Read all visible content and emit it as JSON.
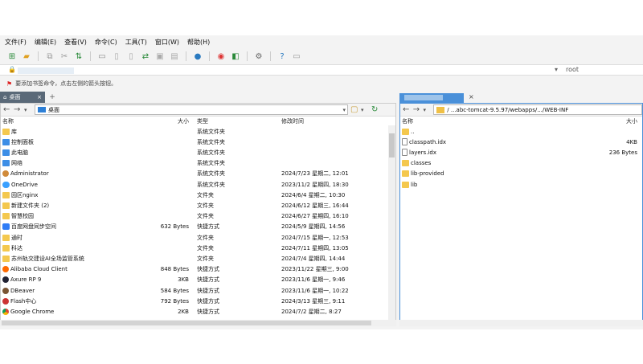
{
  "menu": [
    "文件(F)",
    "编辑(E)",
    "查看(V)",
    "命令(C)",
    "工具(T)",
    "窗口(W)",
    "帮助(H)"
  ],
  "address": {
    "user": "root"
  },
  "notice": "要添加书签命令，点击左侧的箭头按钮。",
  "tab": {
    "label": "桌面",
    "close": "×",
    "add": "+"
  },
  "left": {
    "path": "桌面",
    "columns": {
      "name": "名称",
      "size": "大小",
      "type": "类型",
      "date": "修改时间"
    },
    "rows": [
      {
        "name": "库",
        "size": "",
        "type": "系统文件夹",
        "date": "",
        "icon": "fld"
      },
      {
        "name": "控制面板",
        "size": "",
        "type": "系统文件夹",
        "date": "",
        "icon": "sys"
      },
      {
        "name": "此电脑",
        "size": "",
        "type": "系统文件夹",
        "date": "",
        "icon": "sys"
      },
      {
        "name": "网络",
        "size": "",
        "type": "系统文件夹",
        "date": "",
        "icon": "sys"
      },
      {
        "name": "Administrator",
        "size": "",
        "type": "系统文件夹",
        "date": "2024/7/23 星期二, 12:01",
        "icon": "user"
      },
      {
        "name": "OneDrive",
        "size": "",
        "type": "系统文件夹",
        "date": "2023/11/2 星期四, 18:30",
        "icon": "cloud"
      },
      {
        "name": "园区nginx",
        "size": "",
        "type": "文件夹",
        "date": "2024/6/4 星期二, 10:30",
        "icon": "fld"
      },
      {
        "name": "新建文件夹 (2)",
        "size": "",
        "type": "文件夹",
        "date": "2024/6/12 星期三, 16:44",
        "icon": "fld"
      },
      {
        "name": "智慧校园",
        "size": "",
        "type": "文件夹",
        "date": "2024/6/27 星期四, 16:10",
        "icon": "fld"
      },
      {
        "name": "百度网盘同步空间",
        "size": "632 Bytes",
        "type": "快捷方式",
        "date": "2024/5/9 星期四, 14:56",
        "icon": "baidu"
      },
      {
        "name": "通时",
        "size": "",
        "type": "文件夹",
        "date": "2024/7/15 星期一, 12:53",
        "icon": "fld"
      },
      {
        "name": "科达",
        "size": "",
        "type": "文件夹",
        "date": "2024/7/11 星期四, 13:05",
        "icon": "fld"
      },
      {
        "name": "苏州轨交建设AI全场监管系统",
        "size": "",
        "type": "文件夹",
        "date": "2024/7/4 星期四, 14:44",
        "icon": "fld"
      },
      {
        "name": "Alibaba Cloud Client",
        "size": "848 Bytes",
        "type": "快捷方式",
        "date": "2023/11/22 星期三, 9:00",
        "icon": "alibaba"
      },
      {
        "name": "Axure RP 9",
        "size": "3KB",
        "type": "快捷方式",
        "date": "2023/11/6 星期一, 9:46",
        "icon": "axure"
      },
      {
        "name": "DBeaver",
        "size": "584 Bytes",
        "type": "快捷方式",
        "date": "2023/11/6 星期一, 10:22",
        "icon": "dbeaver"
      },
      {
        "name": "Flash中心",
        "size": "792 Bytes",
        "type": "快捷方式",
        "date": "2024/3/13 星期三, 9:11",
        "icon": "flash"
      },
      {
        "name": "Google Chrome",
        "size": "2KB",
        "type": "快捷方式",
        "date": "2024/7/2 星期二, 8:27",
        "icon": "chrome"
      }
    ]
  },
  "right": {
    "path": "/ ...abc-tomcat-9.5.97/webapps/.../WEB-INF",
    "columns": {
      "name": "名称",
      "size": "大小"
    },
    "rows": [
      {
        "name": "..",
        "size": "",
        "icon": "fld"
      },
      {
        "name": "classpath.idx",
        "size": "4KB",
        "icon": "file"
      },
      {
        "name": "layers.idx",
        "size": "236 Bytes",
        "icon": "file"
      },
      {
        "name": "classes",
        "size": "",
        "icon": "fld"
      },
      {
        "name": "lib-provided",
        "size": "",
        "icon": "fld"
      },
      {
        "name": "lib",
        "size": "",
        "icon": "fld"
      }
    ]
  }
}
